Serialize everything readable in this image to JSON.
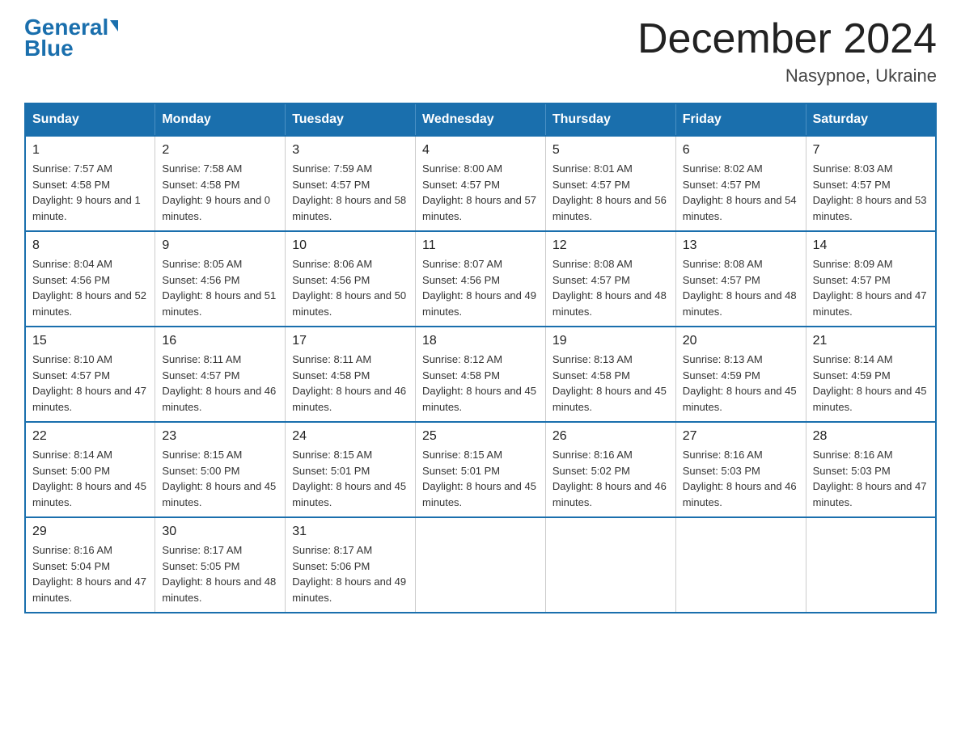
{
  "header": {
    "logo_general": "General",
    "logo_blue": "Blue",
    "month_title": "December 2024",
    "location": "Nasypnoe, Ukraine"
  },
  "days_of_week": [
    "Sunday",
    "Monday",
    "Tuesday",
    "Wednesday",
    "Thursday",
    "Friday",
    "Saturday"
  ],
  "weeks": [
    [
      {
        "day": "1",
        "sunrise": "7:57 AM",
        "sunset": "4:58 PM",
        "daylight": "9 hours and 1 minute."
      },
      {
        "day": "2",
        "sunrise": "7:58 AM",
        "sunset": "4:58 PM",
        "daylight": "9 hours and 0 minutes."
      },
      {
        "day": "3",
        "sunrise": "7:59 AM",
        "sunset": "4:57 PM",
        "daylight": "8 hours and 58 minutes."
      },
      {
        "day": "4",
        "sunrise": "8:00 AM",
        "sunset": "4:57 PM",
        "daylight": "8 hours and 57 minutes."
      },
      {
        "day": "5",
        "sunrise": "8:01 AM",
        "sunset": "4:57 PM",
        "daylight": "8 hours and 56 minutes."
      },
      {
        "day": "6",
        "sunrise": "8:02 AM",
        "sunset": "4:57 PM",
        "daylight": "8 hours and 54 minutes."
      },
      {
        "day": "7",
        "sunrise": "8:03 AM",
        "sunset": "4:57 PM",
        "daylight": "8 hours and 53 minutes."
      }
    ],
    [
      {
        "day": "8",
        "sunrise": "8:04 AM",
        "sunset": "4:56 PM",
        "daylight": "8 hours and 52 minutes."
      },
      {
        "day": "9",
        "sunrise": "8:05 AM",
        "sunset": "4:56 PM",
        "daylight": "8 hours and 51 minutes."
      },
      {
        "day": "10",
        "sunrise": "8:06 AM",
        "sunset": "4:56 PM",
        "daylight": "8 hours and 50 minutes."
      },
      {
        "day": "11",
        "sunrise": "8:07 AM",
        "sunset": "4:56 PM",
        "daylight": "8 hours and 49 minutes."
      },
      {
        "day": "12",
        "sunrise": "8:08 AM",
        "sunset": "4:57 PM",
        "daylight": "8 hours and 48 minutes."
      },
      {
        "day": "13",
        "sunrise": "8:08 AM",
        "sunset": "4:57 PM",
        "daylight": "8 hours and 48 minutes."
      },
      {
        "day": "14",
        "sunrise": "8:09 AM",
        "sunset": "4:57 PM",
        "daylight": "8 hours and 47 minutes."
      }
    ],
    [
      {
        "day": "15",
        "sunrise": "8:10 AM",
        "sunset": "4:57 PM",
        "daylight": "8 hours and 47 minutes."
      },
      {
        "day": "16",
        "sunrise": "8:11 AM",
        "sunset": "4:57 PM",
        "daylight": "8 hours and 46 minutes."
      },
      {
        "day": "17",
        "sunrise": "8:11 AM",
        "sunset": "4:58 PM",
        "daylight": "8 hours and 46 minutes."
      },
      {
        "day": "18",
        "sunrise": "8:12 AM",
        "sunset": "4:58 PM",
        "daylight": "8 hours and 45 minutes."
      },
      {
        "day": "19",
        "sunrise": "8:13 AM",
        "sunset": "4:58 PM",
        "daylight": "8 hours and 45 minutes."
      },
      {
        "day": "20",
        "sunrise": "8:13 AM",
        "sunset": "4:59 PM",
        "daylight": "8 hours and 45 minutes."
      },
      {
        "day": "21",
        "sunrise": "8:14 AM",
        "sunset": "4:59 PM",
        "daylight": "8 hours and 45 minutes."
      }
    ],
    [
      {
        "day": "22",
        "sunrise": "8:14 AM",
        "sunset": "5:00 PM",
        "daylight": "8 hours and 45 minutes."
      },
      {
        "day": "23",
        "sunrise": "8:15 AM",
        "sunset": "5:00 PM",
        "daylight": "8 hours and 45 minutes."
      },
      {
        "day": "24",
        "sunrise": "8:15 AM",
        "sunset": "5:01 PM",
        "daylight": "8 hours and 45 minutes."
      },
      {
        "day": "25",
        "sunrise": "8:15 AM",
        "sunset": "5:01 PM",
        "daylight": "8 hours and 45 minutes."
      },
      {
        "day": "26",
        "sunrise": "8:16 AM",
        "sunset": "5:02 PM",
        "daylight": "8 hours and 46 minutes."
      },
      {
        "day": "27",
        "sunrise": "8:16 AM",
        "sunset": "5:03 PM",
        "daylight": "8 hours and 46 minutes."
      },
      {
        "day": "28",
        "sunrise": "8:16 AM",
        "sunset": "5:03 PM",
        "daylight": "8 hours and 47 minutes."
      }
    ],
    [
      {
        "day": "29",
        "sunrise": "8:16 AM",
        "sunset": "5:04 PM",
        "daylight": "8 hours and 47 minutes."
      },
      {
        "day": "30",
        "sunrise": "8:17 AM",
        "sunset": "5:05 PM",
        "daylight": "8 hours and 48 minutes."
      },
      {
        "day": "31",
        "sunrise": "8:17 AM",
        "sunset": "5:06 PM",
        "daylight": "8 hours and 49 minutes."
      },
      null,
      null,
      null,
      null
    ]
  ]
}
